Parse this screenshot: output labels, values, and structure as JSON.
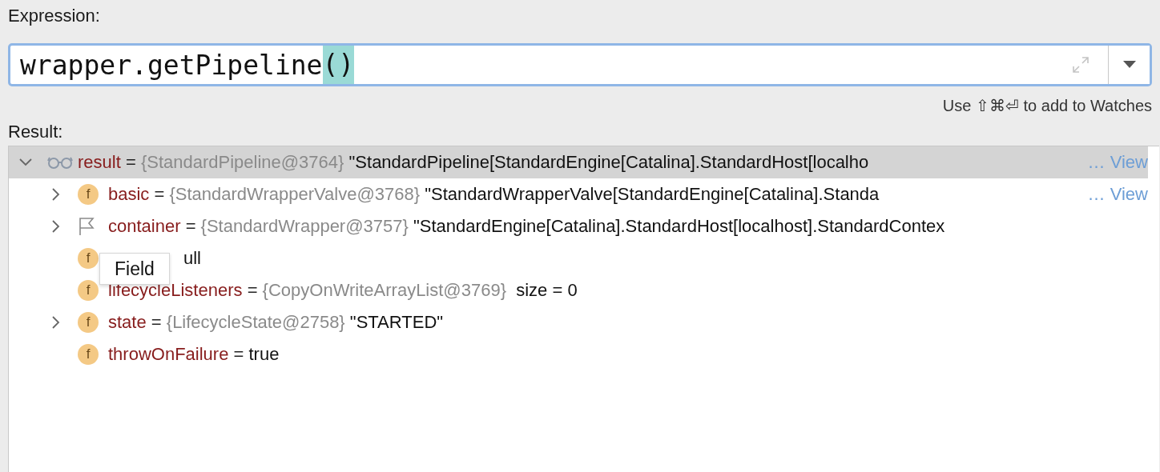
{
  "expression": {
    "label": "Expression:",
    "value": "wrapper.getPipeline",
    "highlighted": "()",
    "hint": "Use ⇧⌘⏎ to add to Watches"
  },
  "result": {
    "label": "Result:",
    "tree": {
      "kind": "watch",
      "name": "result",
      "operator": "=",
      "ref": "{StandardPipeline@3764}",
      "value": "\"StandardPipeline[StandardEngine[Catalina].StandardHost[localho",
      "link": "… View",
      "selected": true,
      "expanded": true,
      "children": [
        {
          "kind": "field",
          "badge": "f",
          "name": "basic",
          "operator": "=",
          "ref": "{StandardWrapperValve@3768}",
          "value": "\"StandardWrapperValve[StandardEngine[Catalina].Standa",
          "link": "… View",
          "selected": false,
          "expanded": false
        },
        {
          "kind": "flag",
          "name": "container",
          "operator": "=",
          "ref": "{StandardWrapper@3757}",
          "value": "\"StandardEngine[Catalina].StandardHost[localhost].StandardContex",
          "selected": false,
          "expanded": false
        },
        {
          "kind": "field",
          "badge": "f",
          "value": "ull",
          "selected": false
        },
        {
          "kind": "field",
          "badge": "f",
          "name": "lifecycleListeners",
          "operator": "=",
          "ref": "{CopyOnWriteArrayList@3769}",
          "value": " size = 0",
          "selected": false
        },
        {
          "kind": "field",
          "badge": "f",
          "name": "state",
          "operator": "=",
          "ref": "{LifecycleState@2758}",
          "value": "\"STARTED\"",
          "selected": false,
          "expanded": false
        },
        {
          "kind": "field",
          "badge": "f",
          "name": "throwOnFailure",
          "operator": "=",
          "value": "true",
          "selected": false
        }
      ]
    }
  },
  "tooltip": {
    "text": "Field"
  }
}
